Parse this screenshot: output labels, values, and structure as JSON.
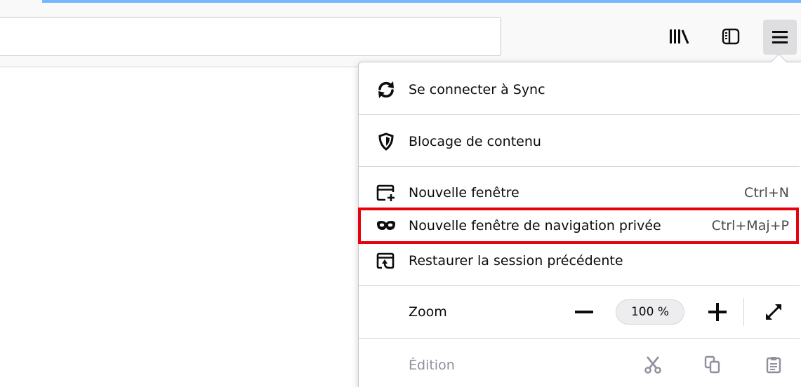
{
  "toolbar": {
    "library_icon": "library-icon",
    "sidebar_icon": "sidebar-icon",
    "menu_icon": "hamburger-menu-icon"
  },
  "menu": {
    "sync": {
      "label": "Se connecter à Sync",
      "icon": "sync-icon"
    },
    "content_blocking": {
      "label": "Blocage de contenu",
      "icon": "shield-icon"
    },
    "new_window": {
      "label": "Nouvelle fenêtre",
      "shortcut": "Ctrl+N",
      "icon": "new-window-icon"
    },
    "private_window": {
      "label": "Nouvelle fenêtre de navigation privée",
      "shortcut": "Ctrl+Maj+P",
      "icon": "private-mask-icon"
    },
    "restore_session": {
      "label": "Restaurer la session précédente",
      "icon": "restore-session-icon"
    },
    "zoom": {
      "label": "Zoom",
      "minus": "−",
      "value": "100 %",
      "plus": "+",
      "fullscreen_icon": "fullscreen-icon"
    },
    "edit": {
      "label": "Édition",
      "cut_icon": "cut-icon",
      "copy_icon": "copy-icon",
      "paste_icon": "paste-icon"
    }
  },
  "colors": {
    "highlight": "#e8000b",
    "accent": "#0a84ff"
  }
}
